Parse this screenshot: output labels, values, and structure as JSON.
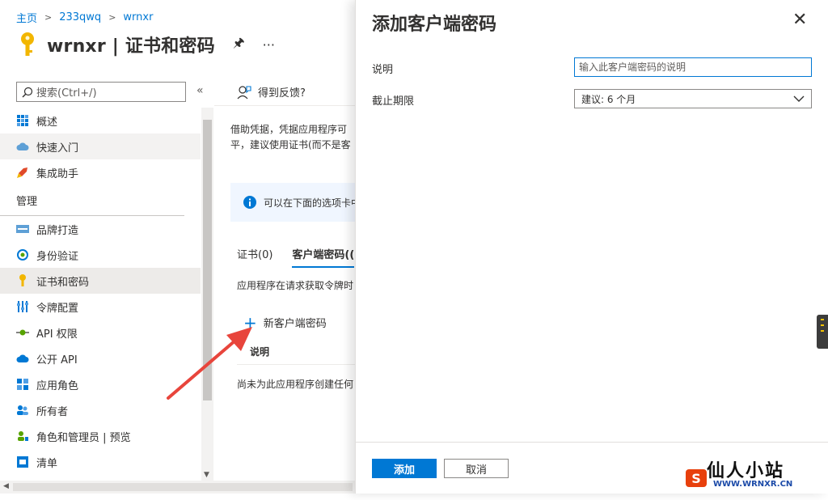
{
  "breadcrumb": [
    "主页",
    "233qwq",
    "wrnxr"
  ],
  "page": {
    "title": "wrnxr | 证书和密码",
    "pin_icon": "pin-icon",
    "more": "···"
  },
  "nav": {
    "search_placeholder": "搜索(Ctrl+/)",
    "collapse": "«",
    "items": [
      {
        "label": "概述",
        "icon": "grid-icon",
        "state": "normal"
      },
      {
        "label": "快速入门",
        "icon": "cloud-icon",
        "state": "hover"
      },
      {
        "label": "集成助手",
        "icon": "rocket-icon",
        "state": "normal"
      }
    ],
    "section": "管理",
    "manage_items": [
      {
        "label": "品牌打造",
        "icon": "branding-icon",
        "state": "normal"
      },
      {
        "label": "身份验证",
        "icon": "auth-icon",
        "state": "normal"
      },
      {
        "label": "证书和密码",
        "icon": "key-icon",
        "state": "active"
      },
      {
        "label": "令牌配置",
        "icon": "token-icon",
        "state": "normal"
      },
      {
        "label": "API 权限",
        "icon": "api-permission-icon",
        "state": "normal"
      },
      {
        "label": "公开 API",
        "icon": "cloud-api-icon",
        "state": "normal"
      },
      {
        "label": "应用角色",
        "icon": "app-roles-icon",
        "state": "normal"
      },
      {
        "label": "所有者",
        "icon": "owners-icon",
        "state": "normal"
      },
      {
        "label": "角色和管理员 | 预览",
        "icon": "roles-admin-icon",
        "state": "normal"
      },
      {
        "label": "清单",
        "icon": "manifest-icon",
        "state": "normal"
      }
    ]
  },
  "content": {
    "feedback": "得到反馈?",
    "desc_line1": "借助凭据，凭据应用程序可",
    "desc_line2": "平，建议使用证书(而不是客",
    "info": "可以在下面的选项卡中",
    "tabs": [
      "证书(0)",
      "客户端密码(("
    ],
    "tab_desc": "应用程序在请求获取令牌时",
    "new_secret": "新客户端密码",
    "column_header": "说明",
    "empty_text": "尚未为此应用程序创建任何"
  },
  "panel": {
    "title": "添加客户端密码",
    "description_label": "说明",
    "description_placeholder": "输入此客户端密码的说明",
    "expiry_label": "截止期限",
    "expiry_value": "建议: 6 个月",
    "add_button": "添加",
    "cancel_button": "取消"
  },
  "watermark": {
    "text": "仙人小站",
    "url": "WWW.WRNXR.CN",
    "badge": "S"
  },
  "colors": {
    "accent": "#0078d4",
    "info_bg": "#f0f6ff",
    "arrow": "#e8453c"
  }
}
